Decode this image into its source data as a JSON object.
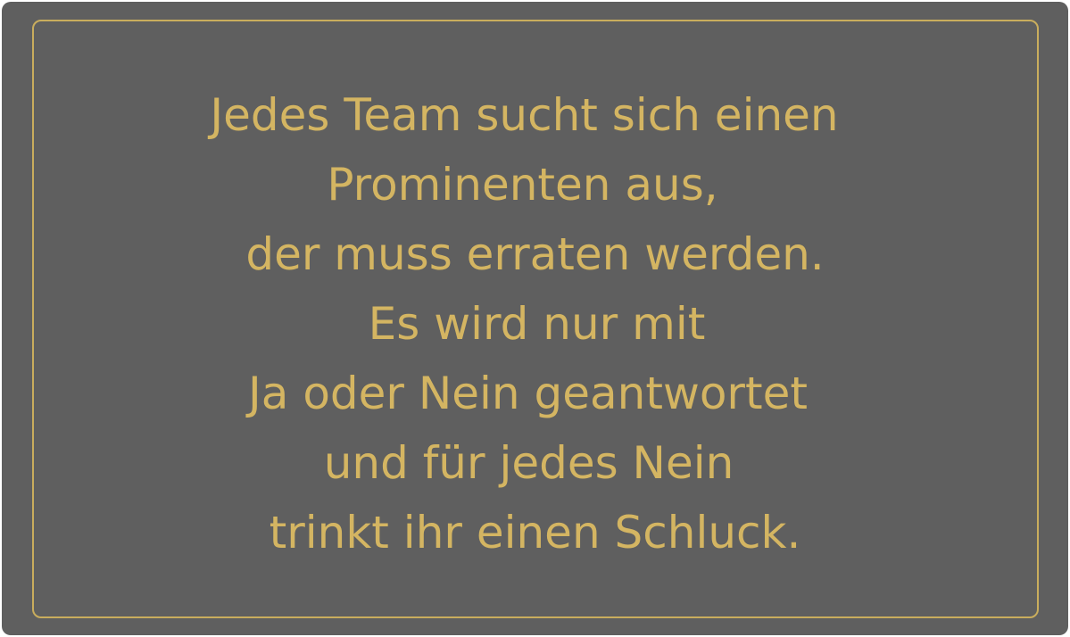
{
  "card": {
    "background_color": "#5f5f5f",
    "border_color": "#c9ad5d",
    "text_color": "#d4b562",
    "lines": [
      "Jedes Team sucht sich einen",
      "Prominenten aus,",
      "der muss erraten werden.",
      "Es wird nur mit",
      "Ja oder Nein geantwortet",
      "und für jedes Nein",
      "trinkt ihr einen Schluck."
    ]
  }
}
